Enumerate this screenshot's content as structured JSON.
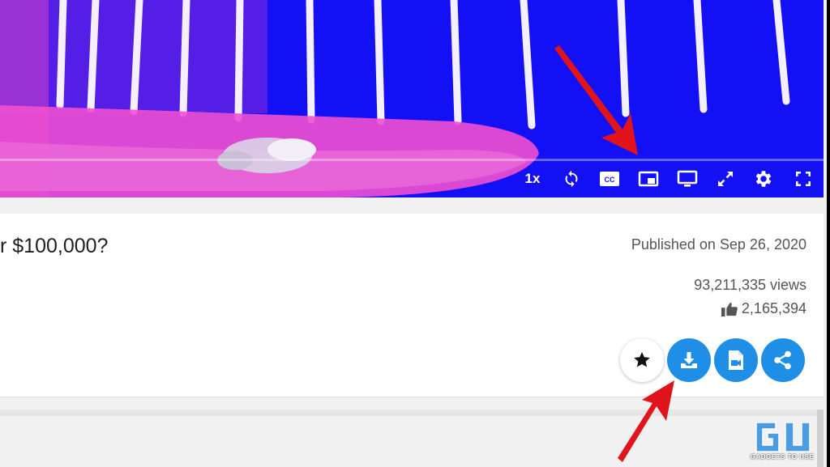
{
  "video": {
    "playback_speed": "1x",
    "controls": [
      "speed",
      "loop",
      "captions",
      "picture-in-picture",
      "cast",
      "expand",
      "settings",
      "fullscreen"
    ]
  },
  "details": {
    "title": "r $100,000?",
    "published": "Published on Sep 26, 2020",
    "views": "93,211,335 views",
    "likes": "2,165,394"
  },
  "actions": [
    "favorite",
    "download",
    "video-file",
    "share"
  ],
  "colors": {
    "video_bg": "#1410f5",
    "action_blue": "#1f8ee6",
    "annotation_red": "#e0141a"
  },
  "watermark": {
    "logo": "GU",
    "text": "GADGETS TO USE"
  }
}
